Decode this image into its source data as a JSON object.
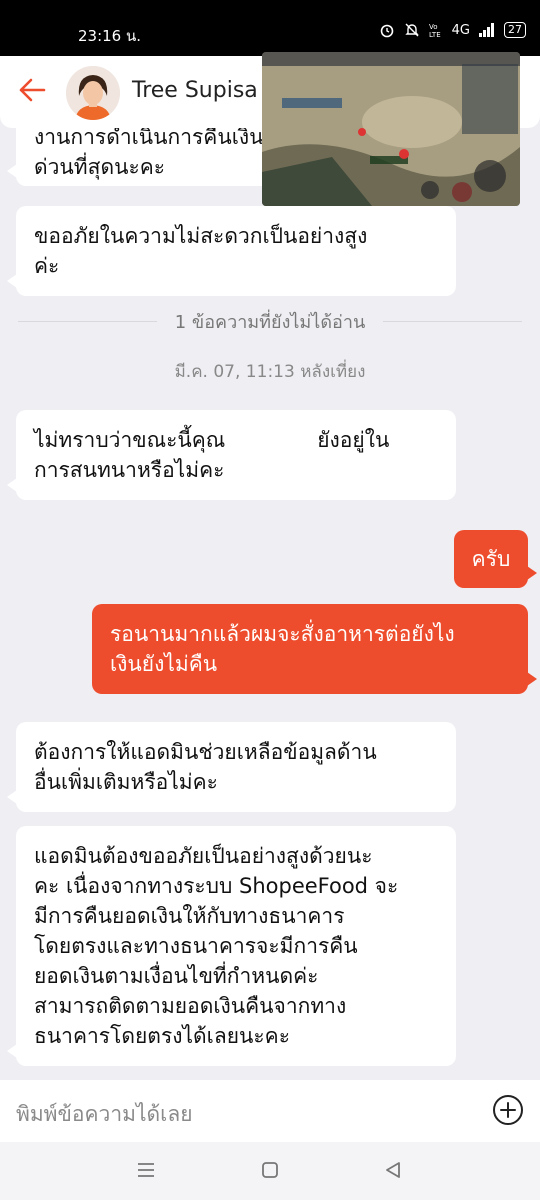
{
  "status_bar": {
    "time": "23:16 น.",
    "network": "4G",
    "battery": "27"
  },
  "header": {
    "contact_name": "Tree Supisa"
  },
  "divider": {
    "unread_label": "1 ข้อความที่ยังไม่ได้อ่าน"
  },
  "timestamp": "มี.ค. 07, 11:13 หลังเที่ยง",
  "messages": [
    {
      "line1": "งานการดำเนินการคืนเงิน",
      "line2": "ด่วนที่สุดนะคะ"
    },
    {
      "line1": "ขออภัยในความไม่สะดวกเป็นอย่างสูง",
      "line2": "ค่ะ"
    },
    {
      "line1a": "ไม่ทราบว่าขณะนี้คุณ",
      "line1b": "ยังอยู่ใน",
      "line2": "การสนทนาหรือไม่คะ"
    },
    {
      "line1": "ครับ"
    },
    {
      "line1": "รอนานมากแล้วผมจะสั่งอาหารต่อยังไง",
      "line2": "เงินยังไม่คืน"
    },
    {
      "line1": "ต้องการให้แอดมินช่วยเหลือข้อมูลด้าน",
      "line2": "อื่นเพิ่มเติมหรือไม่คะ"
    },
    {
      "lines": [
        "แอดมินต้องขออภัยเป็นอย่างสูงด้วยนะ",
        "คะ เนื่องจากทางระบบ ShopeeFood จะ",
        "มีการคืนยอดเงินให้กับทางธนาคาร",
        "โดยตรงและทางธนาคารจะมีการคืน",
        "ยอดเงินตามเงื่อนไขที่กำหนดค่ะ",
        "สามารถติดตามยอดเงินคืนจากทาง",
        "ธนาคารโดยตรงได้เลยนะคะ"
      ]
    }
  ],
  "composer": {
    "placeholder": "พิมพ์ข้อความได้เลย"
  },
  "colors": {
    "accent": "#ee4d2d",
    "background": "#efeef3"
  },
  "icons": [
    "back-arrow-icon",
    "plus-circle-icon",
    "menu-icon",
    "home-icon",
    "back-icon"
  ]
}
